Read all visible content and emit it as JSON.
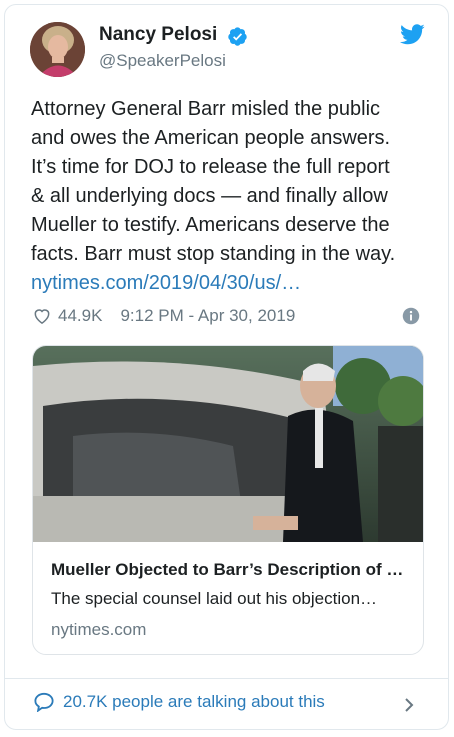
{
  "author": {
    "name": "Nancy Pelosi",
    "handle": "@SpeakerPelosi",
    "verified": true
  },
  "tweet": {
    "lines": [
      "Attorney General Barr misled the public",
      "and owes the American people answers.",
      "It’s time for DOJ to release the full report",
      "& all underlying docs — and finally allow",
      "Mueller to testify. Americans deserve the",
      "facts. Barr must stop standing in the way."
    ],
    "link": "nytimes.com/2019/04/30/us/…",
    "likes": "44.9K",
    "timestamp": "9:12 PM - Apr 30, 2019"
  },
  "embed": {
    "title": "Mueller Objected to Barr’s Description of …",
    "description": "The special counsel laid out his objection…",
    "domain": "nytimes.com"
  },
  "footer": {
    "talking": "20.7K people are talking about this"
  },
  "colors": {
    "twitter_blue": "#1da1f2",
    "link": "#2b7bb9",
    "muted": "#697882",
    "text": "#1c2022"
  },
  "icons": [
    "twitter-bird-icon",
    "verified-badge-icon",
    "heart-icon",
    "info-icon",
    "speech-bubble-icon",
    "chevron-right-icon"
  ]
}
